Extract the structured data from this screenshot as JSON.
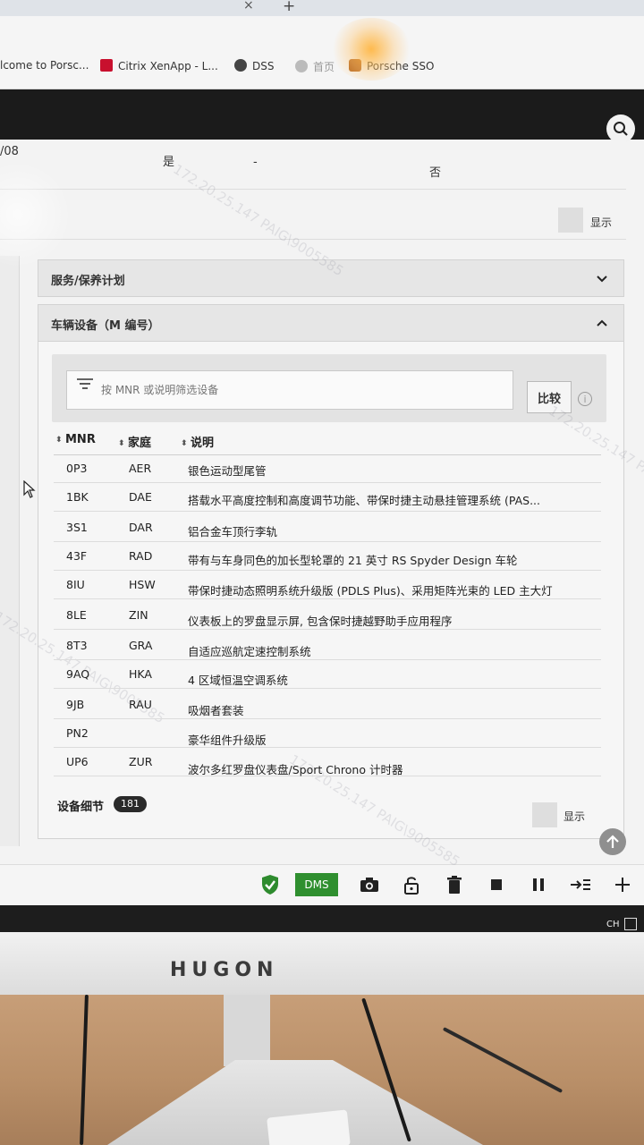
{
  "browser": {
    "tab_close": "×",
    "tab_new": "+",
    "bookmarks": [
      {
        "label": "lcome to Porsc...",
        "color": ""
      },
      {
        "label": "Citrix XenApp - L...",
        "color": "#c8102e"
      },
      {
        "label": "DSS",
        "color": "#444444"
      },
      {
        "label": "首页",
        "color": "#9a9a9a"
      },
      {
        "label": "Porsche SSO",
        "color": "#b5651d"
      }
    ]
  },
  "top_rows": {
    "date_partial": "/08",
    "yes": "是",
    "dash": "-",
    "no": "否",
    "show": "显示"
  },
  "service_section": {
    "title": "服务/保养计划"
  },
  "equipment_section": {
    "title": "车辆设备（M 编号）",
    "filter_placeholder": "按 MNR 或说明筛选设备",
    "compare_label": "比较",
    "info_glyph": "i",
    "columns": {
      "mnr": "MNR",
      "family": "家庭",
      "desc": "说明"
    },
    "rows": [
      {
        "mnr": "0P3",
        "family": "AER",
        "desc": "银色运动型尾管"
      },
      {
        "mnr": "1BK",
        "family": "DAE",
        "desc": "搭载水平高度控制和高度调节功能、带保时捷主动悬挂管理系统 (PAS..."
      },
      {
        "mnr": "3S1",
        "family": "DAR",
        "desc": "铝合金车顶行李轨"
      },
      {
        "mnr": "43F",
        "family": "RAD",
        "desc": "带有与车身同色的加长型轮罩的 21 英寸 RS Spyder Design 车轮"
      },
      {
        "mnr": "8IU",
        "family": "HSW",
        "desc": "带保时捷动态照明系统升级版 (PDLS Plus)、采用矩阵光束的 LED 主大灯"
      },
      {
        "mnr": "8LE",
        "family": "ZIN",
        "desc": "仪表板上的罗盘显示屏, 包含保时捷越野助手应用程序"
      },
      {
        "mnr": "8T3",
        "family": "GRA",
        "desc": "自适应巡航定速控制系统"
      },
      {
        "mnr": "9AQ",
        "family": "HKA",
        "desc": "4 区域恒温空调系统"
      },
      {
        "mnr": "9JB",
        "family": "RAU",
        "desc": "吸烟者套装"
      },
      {
        "mnr": "PN2",
        "family": "",
        "desc": "豪华组件升级版"
      },
      {
        "mnr": "UP6",
        "family": "ZUR",
        "desc": "波尔多红罗盘仪表盘/Sport Chrono 计时器"
      }
    ],
    "detail_label": "设备细节",
    "detail_count": "181",
    "show": "显示"
  },
  "toolbar": {
    "dms_label": "DMS"
  },
  "taskbar": {
    "ime": "CH"
  },
  "monitor": {
    "brand": "HUGON"
  },
  "watermark": "172.20.25.147 PAIG\\9005585"
}
